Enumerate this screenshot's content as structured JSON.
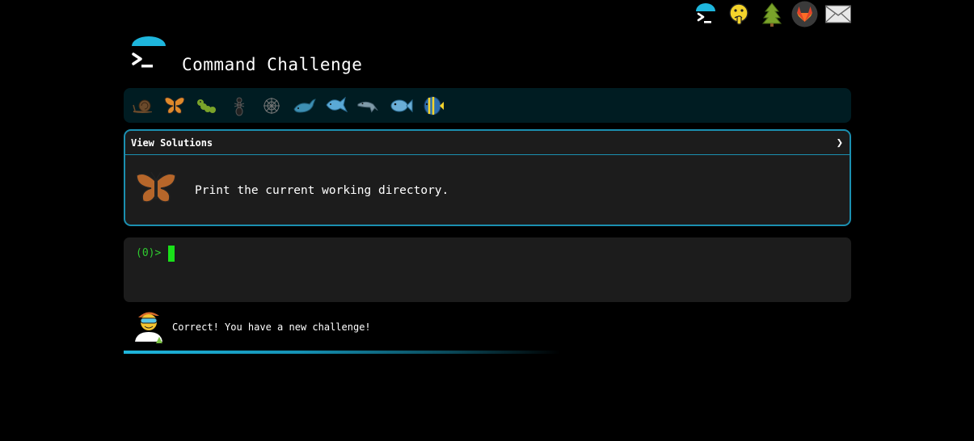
{
  "app": {
    "title": "Command Challenge"
  },
  "top_icons": [
    "terminal-icon",
    "face-icon",
    "tree-icon",
    "gitlab-icon",
    "mail-icon"
  ],
  "levels": [
    "snail",
    "butterfly",
    "caterpillar",
    "ant",
    "spider-web",
    "whale",
    "shark",
    "dolphin",
    "fish",
    "tropical-fish"
  ],
  "challenge": {
    "view_solutions_label": "View Solutions",
    "chevron": "❯",
    "task": "Print the current working directory."
  },
  "terminal": {
    "prompt": "(0)>"
  },
  "status": {
    "message": "Correct! You have a new challenge!"
  },
  "colors": {
    "accent": "#1eb6dd",
    "prompt_green": "#2fcc2f",
    "panel": "#1c1c1c",
    "level_bar": "#001c22"
  }
}
